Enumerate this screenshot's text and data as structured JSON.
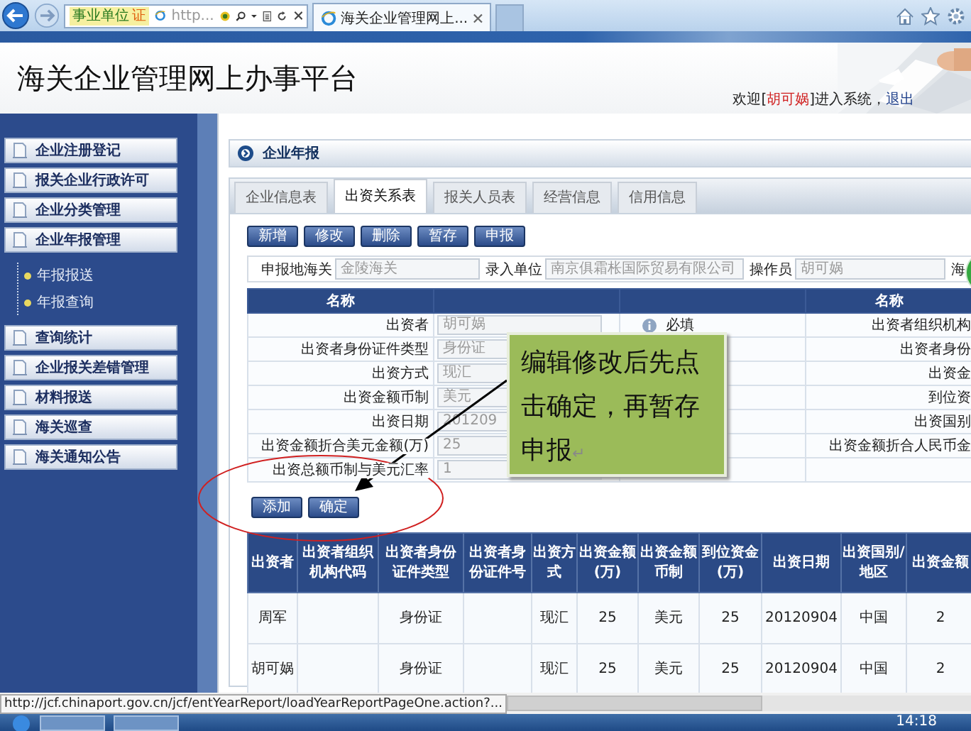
{
  "browser": {
    "nav_chip": "事业单位",
    "chip_badge": "证",
    "address": "http...",
    "tab_title": "海关企业管理网上..."
  },
  "header": {
    "title": "海关企业管理网上办事平台",
    "welcome_prefix": "欢迎[",
    "user": "胡可娲",
    "welcome_suffix": "]进入系统，",
    "logout": "退出"
  },
  "sidebar": {
    "items": [
      {
        "label": "企业注册登记"
      },
      {
        "label": "报关企业行政许可"
      },
      {
        "label": "企业分类管理"
      },
      {
        "label": "企业年报管理",
        "children": [
          {
            "label": "年报报送"
          },
          {
            "label": "年报查询"
          }
        ]
      },
      {
        "label": "查询统计"
      },
      {
        "label": "企业报关差错管理"
      },
      {
        "label": "材料报送"
      },
      {
        "label": "海关巡查"
      },
      {
        "label": "海关通知公告"
      }
    ]
  },
  "panel": {
    "title": "企业年报"
  },
  "tabs": [
    {
      "label": "企业信息表",
      "selected": false
    },
    {
      "label": "出资关系表",
      "selected": true
    },
    {
      "label": "报关人员表",
      "selected": false
    },
    {
      "label": "经营信息",
      "selected": false
    },
    {
      "label": "信用信息",
      "selected": false
    }
  ],
  "toolbar": [
    "新增",
    "修改",
    "删除",
    "暂存",
    "申报"
  ],
  "filters": [
    {
      "label": "申报地海关",
      "value": "金陵海关"
    },
    {
      "label": "录入单位",
      "value": "南京俱霜枨国际贸易有限公司"
    },
    {
      "label": "操作员",
      "value": "胡可娲"
    },
    {
      "label": "海"
    }
  ],
  "form": {
    "header_left": "名称",
    "header_right": "名称",
    "rows": [
      {
        "label": "出资者",
        "value": "胡可娲",
        "note": "必填",
        "right_label": "出资者组织机构"
      },
      {
        "label": "出资者身份证件类型",
        "value": "身份证",
        "right_label": "出资者身份"
      },
      {
        "label": "出资方式",
        "value": "现汇",
        "right_label": "出资金"
      },
      {
        "label": "出资金额币制",
        "value": "美元",
        "right_label": "到位资"
      },
      {
        "label": "出资日期",
        "value": "201209",
        "right_label": "出资国别"
      },
      {
        "label": "出资金额折合美元金额(万)",
        "value": "25",
        "right_label": "出资金额折合人民币金"
      },
      {
        "label": "出资总额币制与美元汇率",
        "value": "1"
      }
    ]
  },
  "form_buttons": [
    "添加",
    "确定"
  ],
  "callout": {
    "text": "编辑修改后先点击确定，再暂存申报",
    "mark": "↵"
  },
  "results": {
    "columns": [
      "出资者",
      "出资者组织机构代码",
      "出资者身份证件类型",
      "出资者身份证件号",
      "出资方式",
      "出资金额(万)",
      "出资金额币制",
      "到位资金(万)",
      "出资日期",
      "出资国别/地区",
      "出资金额"
    ],
    "rows": [
      [
        "周军",
        "",
        "身份证",
        "",
        "现汇",
        "25",
        "美元",
        "25",
        "20120904",
        "中国",
        "2"
      ],
      [
        "胡可娲",
        "",
        "身份证",
        "",
        "现汇",
        "25",
        "美元",
        "25",
        "20120904",
        "中国",
        "2"
      ]
    ]
  },
  "status_url": "http://jcf.chinaport.gov.cn/jcf/entYearReport/loadYearReportPageOne.action?...",
  "taskbar": {
    "clock": "14:18"
  }
}
